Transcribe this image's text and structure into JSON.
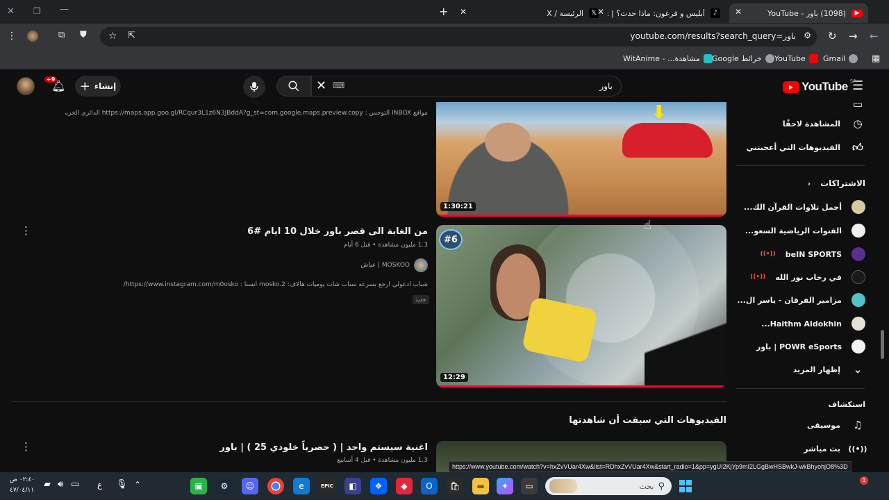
{
  "browser": {
    "tabs": [
      {
        "title": "(1098) باور - YouTube",
        "active": true
      },
      {
        "title": "أبليس و فرعون: ماذا حدث؟ | TikTok",
        "active": false
      },
      {
        "title": "الرئيسة / X",
        "active": false
      }
    ],
    "new_tab": "+",
    "url": "youtube.com/results?search_query=باور",
    "bookmarks": [
      {
        "label": "Gmail",
        "color": "#dddddd"
      },
      {
        "label": "YouTube",
        "color": "#ff0000"
      },
      {
        "label": "خرائط Google",
        "color": "#dddddd"
      },
      {
        "label": "مشاهدة... - WitAnime",
        "color": "#22c1c3"
      }
    ]
  },
  "header": {
    "logo_text": "YouTube",
    "region": "SA",
    "search_value": "باور",
    "create_label": "إنشاء",
    "notif_count": "+9"
  },
  "sidebar": {
    "top_items": [
      {
        "label": "المشاهدة لاحقًا",
        "icon": "clock-icon"
      },
      {
        "label": "الفيديوهات التي أعجبتني",
        "icon": "thumbs-up-icon"
      }
    ],
    "subs_heading": "الاشتراكات",
    "subscriptions": [
      {
        "label": "أجمل تلاوات القرآن الك...",
        "live": true,
        "color": "#d9c9a3"
      },
      {
        "label": "القنوات الرياضية السعو...",
        "live": true,
        "color": "#f0f0f0"
      },
      {
        "label": "beIN SPORTS",
        "live": true,
        "color": "#5b2d91"
      },
      {
        "label": "في رحاب نور الله",
        "live": true,
        "color": "#1a1a1a"
      },
      {
        "label": "مزامير الفرقان - ياسر ال...",
        "live": true,
        "color": "#4fc3c7"
      },
      {
        "label": "Haithm Aldokhin...",
        "live": false,
        "color": "#e6e1d6"
      },
      {
        "label": "POWR eSports | باور",
        "live": false,
        "color": "#f2f2f2"
      }
    ],
    "show_more": "إظهار المزيد",
    "explore_heading": "استكشاف",
    "explore_items": [
      {
        "label": "موسيقى",
        "icon": "music-icon"
      },
      {
        "label": "بث مباشر",
        "icon": "live-icon"
      }
    ]
  },
  "results": {
    "partial_desc": "مواقع INBOX التوجس : https://maps.app.goo.gl/RCqur3L1z6N3JBddA?g_st=com.google.maps.preview.copy الدائري الخربي ...",
    "video1_duration": "1:30:21",
    "video1_progress": 1.0,
    "video2": {
      "title": "من الغابة الى قصر باور خلال 10 ايام #6",
      "meta": "1.3 مليون مشاهدة • قبل 6 أيام",
      "channel": "MOSKOO | عياش",
      "desc": "شباب ادعولي ارجع بسرعه سناب شات يوميات هالاف: mosko.2 انستا : https://www.instagram.com/m0osko/",
      "badge": "جديد",
      "duration": "12:29",
      "thumb_badge": "#6",
      "progress": 1.0
    },
    "section_heading": "الفيديوهات التي سبقت أن شاهدتها",
    "video3": {
      "title": "اغنية سيستم واحد | ( حصرياً خلودي 25 ) | باور",
      "meta": "1.3 مليون مشاهدة • قبل 4 أسابيع"
    }
  },
  "status_url": "https://www.youtube.com/watch?v=hxZvVUar4Xw&list=RDhxZvVUar4Xw&start_radio=1&pp=ygUI2KjYp9mI2LGgBwHSBwkJ-wkBhyohjO8%3D",
  "taskbar": {
    "search_placeholder": "بحث",
    "lang": "ع",
    "time": "٠٢:٤٠ ص",
    "date": "٤٧/٠٤/١١"
  }
}
